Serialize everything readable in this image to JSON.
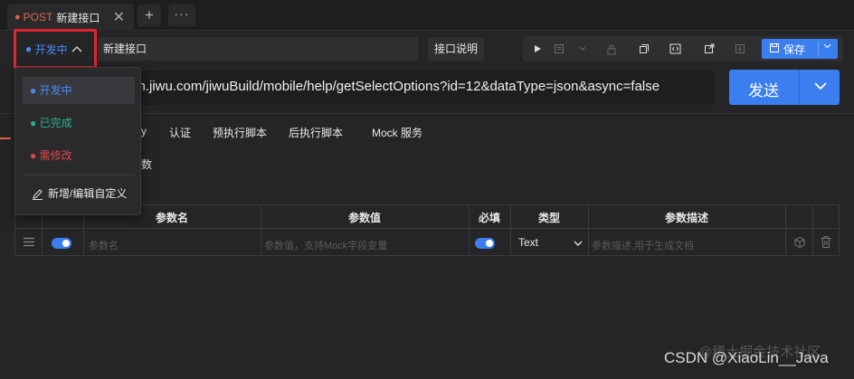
{
  "tab": {
    "method": "POST",
    "title": "新建接口",
    "close": "✕",
    "plus": "+",
    "more": "···"
  },
  "header": {
    "status": "开发中",
    "name_value": "新建接口",
    "desc_button": "接口说明"
  },
  "toolbar": {
    "save_label": "保存"
  },
  "url": {
    "value": "//m.jiwu.com/jiwuBuild/mobile/help/getSelectOptions?id=12&dataType=json&async=false"
  },
  "send": {
    "label": "发送"
  },
  "request_tabs": {
    "partial": "y",
    "auth": "认证",
    "pre_script": "预执行脚本",
    "post_script": "后执行脚本",
    "mock": "Mock 服务"
  },
  "params_label": "数",
  "table": {
    "headers": [
      "参数名",
      "参数值",
      "必填",
      "类型",
      "参数描述"
    ],
    "row": {
      "name_placeholder": "参数名",
      "value_placeholder": "参数值，支持Mock字段变量",
      "type": "Text",
      "desc_placeholder": "参数描述,用于生成文档"
    }
  },
  "dropdown": {
    "items": [
      {
        "label": "开发中",
        "color": "#4a8af4"
      },
      {
        "label": "已完成",
        "color": "#27b48a"
      },
      {
        "label": "需修改",
        "color": "#e04848"
      }
    ],
    "edit_label": "新增/编辑自定义"
  },
  "watermark": {
    "text": "CSDN @XiaoLin__Java",
    "overlay": "@稀土掘金技术社区"
  }
}
